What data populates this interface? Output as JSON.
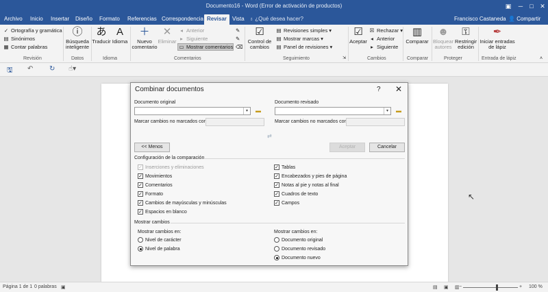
{
  "window": {
    "title": "Documento16 - Word (Error de activación de productos)",
    "user": "Francisco Castaneda",
    "share": "Compartir",
    "tell_me": "¿Qué desea hacer?"
  },
  "tabs": [
    {
      "label": "Archivo"
    },
    {
      "label": "Inicio"
    },
    {
      "label": "Insertar"
    },
    {
      "label": "Diseño"
    },
    {
      "label": "Formato"
    },
    {
      "label": "Referencias"
    },
    {
      "label": "Correspondencia"
    },
    {
      "label": "Revisar",
      "active": true
    },
    {
      "label": "Vista"
    }
  ],
  "ribbon": {
    "revision": {
      "label": "Revisión",
      "ortografia": "Ortografía y gramática",
      "sinonimos": "Sinónimos",
      "contar": "Contar palabras"
    },
    "datos": {
      "label": "Datos",
      "busqueda": "Búsqueda inteligente"
    },
    "idioma": {
      "label": "Idioma",
      "traducir": "Traducir",
      "idioma": "Idioma"
    },
    "comentarios": {
      "label": "Comentarios",
      "nuevo": "Nuevo comentario",
      "eliminar": "Eliminar",
      "anterior": "Anterior",
      "siguiente": "Siguiente",
      "mostrar": "Mostrar comentarios"
    },
    "seguimiento": {
      "label": "Seguimiento",
      "control": "Control de cambios",
      "revisiones": "Revisiones simples",
      "mostrar_marcas": "Mostrar marcas",
      "panel": "Panel de revisiones"
    },
    "cambios": {
      "label": "Cambios",
      "aceptar": "Aceptar",
      "rechazar": "Rechazar",
      "anterior": "Anterior",
      "siguiente": "Siguiente"
    },
    "comparar": {
      "label": "Comparar",
      "comparar": "Comparar"
    },
    "proteger": {
      "label": "Proteger",
      "bloquear": "Bloquear autores",
      "restringir": "Restringir edición"
    },
    "entrada_lapiz": {
      "label": "Entrada de lápiz",
      "iniciar": "Iniciar entradas de lápiz"
    }
  },
  "dialog": {
    "title": "Combinar documentos",
    "help": "?",
    "close": "✕",
    "original_label": "Documento original",
    "revisado_label": "Documento revisado",
    "marcar_label_left": "Marcar cambios no marcados con:",
    "marcar_label_right": "Marcar cambios no marcados con:",
    "menos_button": "<< Menos",
    "aceptar_button": "Aceptar",
    "cancelar_button": "Cancelar",
    "config_header": "Configuración de la comparación",
    "options_left": [
      {
        "label": "Inserciones y eliminaciones",
        "checked": true,
        "disabled": true
      },
      {
        "label": "Movimientos",
        "checked": true
      },
      {
        "label": "Comentarios",
        "checked": true
      },
      {
        "label": "Formato",
        "checked": true
      },
      {
        "label": "Cambios de mayúsculas y minúsculas",
        "checked": true
      },
      {
        "label": "Espacios en blanco",
        "checked": true
      }
    ],
    "options_right": [
      {
        "label": "Tablas",
        "checked": true
      },
      {
        "label": "Encabezados y pies de página",
        "checked": true
      },
      {
        "label": "Notas al pie y notas al final",
        "checked": true
      },
      {
        "label": "Cuadros de texto",
        "checked": true
      },
      {
        "label": "Campos",
        "checked": true
      }
    ],
    "mostrar_header": "Mostrar cambios",
    "mostrar_en_left": "Mostrar cambios en:",
    "nivel_options": [
      {
        "label": "Nivel de carácter",
        "selected": false
      },
      {
        "label": "Nivel de palabra",
        "selected": true
      }
    ],
    "mostrar_en_right": "Mostrar cambios en:",
    "documento_options": [
      {
        "label": "Documento original",
        "selected": false
      },
      {
        "label": "Documento revisado",
        "selected": false
      },
      {
        "label": "Documento nuevo",
        "selected": true
      }
    ]
  },
  "status": {
    "page": "Página 1 de 1",
    "words": "0 palabras",
    "zoom": "100 %"
  }
}
